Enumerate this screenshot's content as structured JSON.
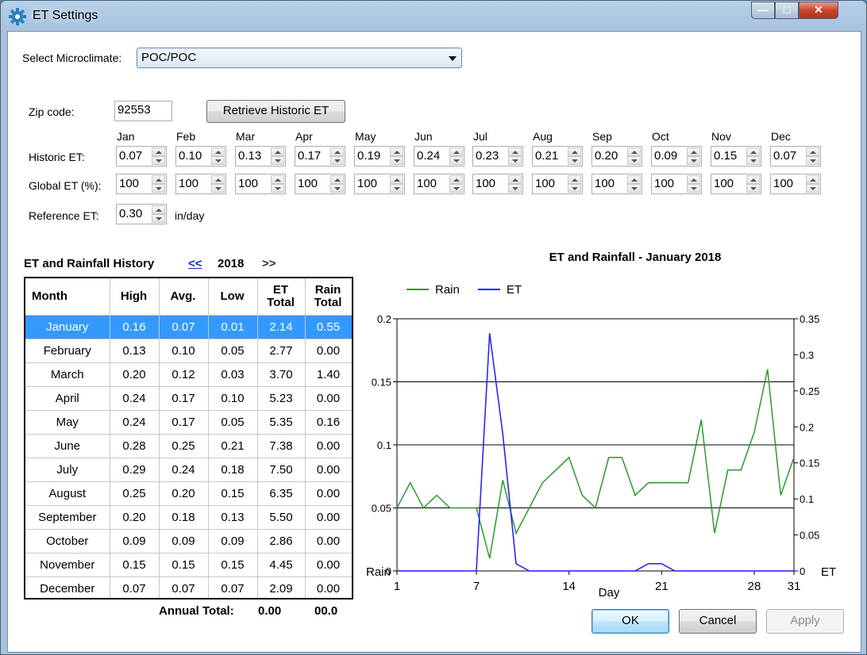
{
  "window": {
    "title": "ET Settings"
  },
  "microclimate": {
    "label": "Select Microclimate:",
    "value": "POC/POC"
  },
  "zip": {
    "label": "Zip code:",
    "value": "92553",
    "retrieve_label": "Retrieve Historic ET"
  },
  "months": [
    "Jan",
    "Feb",
    "Mar",
    "Apr",
    "May",
    "Jun",
    "Jul",
    "Aug",
    "Sep",
    "Oct",
    "Nov",
    "Dec"
  ],
  "historic_et": {
    "label": "Historic ET:",
    "values": [
      "0.07",
      "0.10",
      "0.13",
      "0.17",
      "0.19",
      "0.24",
      "0.23",
      "0.21",
      "0.20",
      "0.09",
      "0.15",
      "0.07"
    ]
  },
  "global_et": {
    "label": "Global ET (%):",
    "values": [
      "100",
      "100",
      "100",
      "100",
      "100",
      "100",
      "100",
      "100",
      "100",
      "100",
      "100",
      "100"
    ]
  },
  "reference_et": {
    "label": "Reference ET:",
    "value": "0.30",
    "unit": "in/day"
  },
  "history": {
    "heading": "ET and Rainfall  History",
    "prev": "<<",
    "year": "2018",
    "next": ">>",
    "columns": [
      "Month",
      "High",
      "Avg.",
      "Low",
      "ET Total",
      "Rain Total"
    ],
    "rows": [
      [
        "January",
        "0.16",
        "0.07",
        "0.01",
        "2.14",
        "0.55"
      ],
      [
        "February",
        "0.13",
        "0.10",
        "0.05",
        "2.77",
        "0.00"
      ],
      [
        "March",
        "0.20",
        "0.12",
        "0.03",
        "3.70",
        "1.40"
      ],
      [
        "April",
        "0.24",
        "0.17",
        "0.10",
        "5.23",
        "0.00"
      ],
      [
        "May",
        "0.24",
        "0.17",
        "0.05",
        "5.35",
        "0.16"
      ],
      [
        "June",
        "0.28",
        "0.25",
        "0.21",
        "7.38",
        "0.00"
      ],
      [
        "July",
        "0.29",
        "0.24",
        "0.18",
        "7.50",
        "0.00"
      ],
      [
        "August",
        "0.25",
        "0.20",
        "0.15",
        "6.35",
        "0.00"
      ],
      [
        "September",
        "0.20",
        "0.18",
        "0.13",
        "5.50",
        "0.00"
      ],
      [
        "October",
        "0.09",
        "0.09",
        "0.09",
        "2.86",
        "0.00"
      ],
      [
        "November",
        "0.15",
        "0.15",
        "0.15",
        "4.45",
        "0.00"
      ],
      [
        "December",
        "0.07",
        "0.07",
        "0.07",
        "2.09",
        "0.00"
      ]
    ],
    "selected_index": 0,
    "annual_label": "Annual Total:",
    "annual_et": "0.00",
    "annual_rain": "00.0"
  },
  "buttons": {
    "ok": "OK",
    "cancel": "Cancel",
    "apply": "Apply"
  },
  "chart_data": {
    "type": "line",
    "title": "ET and Rainfall - January 2018",
    "xlabel": "Day",
    "ylabel_left": "Rain",
    "ylabel_right": "ET",
    "xlim": [
      1,
      31
    ],
    "xticks": [
      1,
      7,
      14,
      21,
      28,
      31
    ],
    "ylim_left": [
      0,
      0.2
    ],
    "yticks_left": [
      "0",
      "0.05",
      "0.1",
      "0.15",
      "0.2"
    ],
    "ylim_right": [
      0,
      0.35
    ],
    "yticks_right": [
      "0",
      "0.05",
      "0.1",
      "0.15",
      "0.2",
      "0.25",
      "0.3",
      "0.35"
    ],
    "legend": "top-left",
    "grid": "horizontal",
    "series": [
      {
        "name": "Rain",
        "axis": "left",
        "color": "#2a9a2a",
        "x": [
          1,
          2,
          3,
          4,
          5,
          6,
          7,
          8,
          9,
          10,
          11,
          12,
          13,
          14,
          15,
          16,
          17,
          18,
          19,
          20,
          21,
          22,
          23,
          24,
          25,
          26,
          27,
          28,
          29,
          30,
          31
        ],
        "values": [
          0.05,
          0.07,
          0.05,
          0.06,
          0.05,
          0.05,
          0.05,
          0.01,
          0.072,
          0.03,
          0.05,
          0.07,
          0.08,
          0.09,
          0.06,
          0.05,
          0.09,
          0.09,
          0.06,
          0.07,
          0.07,
          0.07,
          0.07,
          0.12,
          0.03,
          0.08,
          0.08,
          0.11,
          0.16,
          0.06,
          0.09
        ]
      },
      {
        "name": "ET",
        "axis": "right",
        "color": "#1a1aff",
        "x": [
          1,
          2,
          3,
          4,
          5,
          6,
          7,
          8,
          9,
          10,
          11,
          12,
          13,
          14,
          15,
          16,
          17,
          18,
          19,
          20,
          21,
          22,
          23,
          24,
          25,
          26,
          27,
          28,
          29,
          30,
          31
        ],
        "values": [
          0,
          0,
          0,
          0,
          0,
          0,
          0,
          0.33,
          0.19,
          0.01,
          0,
          0,
          0,
          0,
          0,
          0,
          0,
          0,
          0,
          0.01,
          0.01,
          0,
          0,
          0,
          0,
          0,
          0,
          0,
          0,
          0,
          0
        ]
      }
    ]
  }
}
